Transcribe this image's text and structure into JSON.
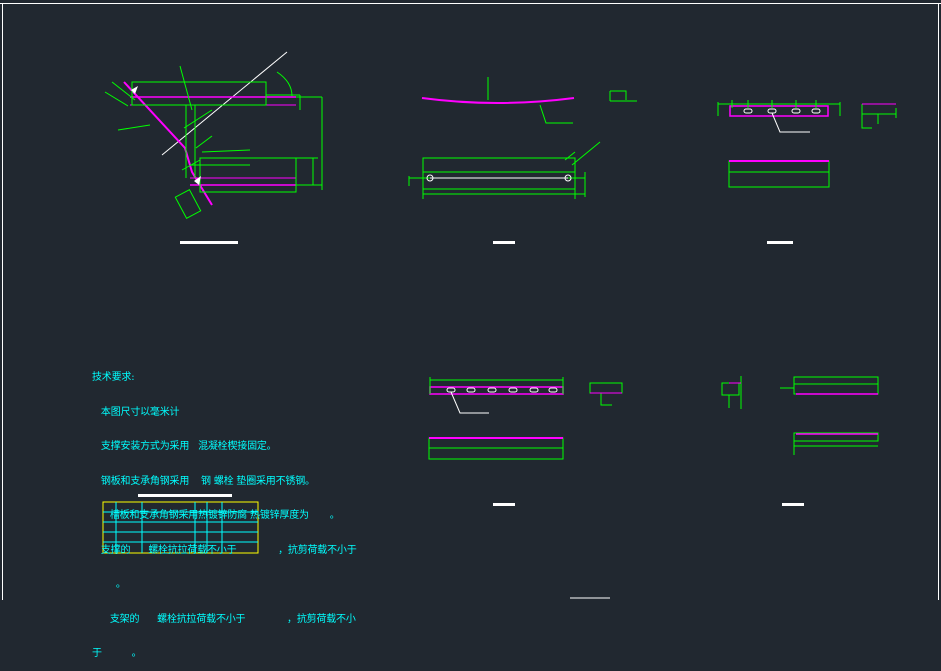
{
  "drawing": {
    "colors": {
      "background": "#212830",
      "frame": "#ffffff",
      "dimension": "#00ff00",
      "steel": "#ff00ff",
      "text": "#00ffff",
      "table_border": "#ffff00",
      "title_bar": "#ffffff"
    },
    "technical_notes": {
      "lines": [
        "技术要求:",
        "   本图尺寸以毫米计",
        "   支撑安装方式为采用   混凝栓楔接固定。",
        "   钢板和支承角钢采用    钢 螺栓 垫圈采用不锈钢。",
        "      槽板和支承角钢采用热镀锌防腐 热镀锌厚度为       。",
        "   支撑的      螺栓抗拉荷载不小于              ，抗剪荷载不小于",
        "        。",
        "      支架的      螺栓抗拉荷载不小于              ，抗剪荷载不小",
        "于          。"
      ]
    }
  }
}
